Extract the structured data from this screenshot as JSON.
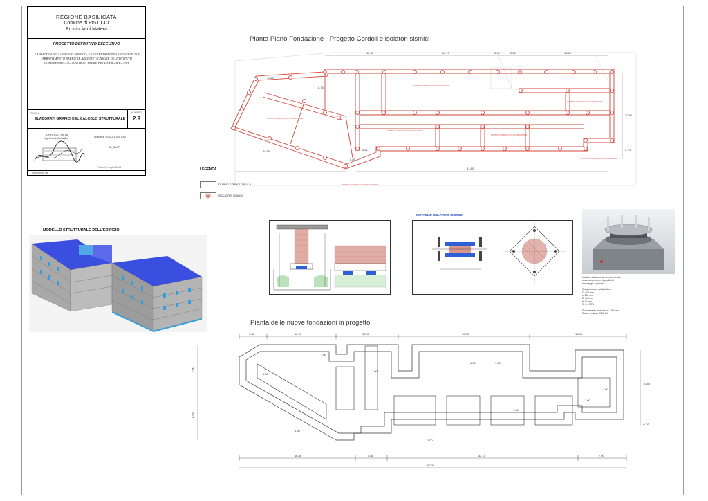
{
  "title_block": {
    "region": "REGIONE  BASILICATA",
    "comune": "Comune di PISTICCI",
    "provincia": "Provincia di Matera",
    "phase": "PROGETTO  DEFINITIVO-ESECUTIVO",
    "works": "LAVORI DI ADEGUAMENTO SISMICO, EFFICIENTAMENTO ENERGETICO E ABBATTIMENTO BARRIERE ARCHITETTONICHE DELL'ISTITUTO COMPRENSIVO SCOLASTICO \"PADRE PIO DA PIETRALCINA\"",
    "section_label": "TAVOLA",
    "drawing_title": "ELABORATI GRAFICI DEL CALCOLO STRUTTURALE",
    "number_label": "NUMERO",
    "drawing_number": "2.9",
    "designer_label": "IL PROGETTISTA",
    "designer_name": "Ing. Antonio Battaglini",
    "scale": "SEMBRE  SCALA  1:200 1:50",
    "file": "ID_N.N.P",
    "date": "Pisticci, lì luglio 2018",
    "footer": "Riferimento file:"
  },
  "plans": {
    "foundation_plan_title": "Pianta Piano Fondazione - Progetto Cordoli e isolatori sismici-",
    "new_foundations_title": "Pianta delle nuove fondazioni in progetto"
  },
  "legend": {
    "title": "LEGENDA",
    "items": [
      {
        "label": "DOPPIO CORDOLO IN C.A."
      },
      {
        "label": "ISOLATORI SISMICI"
      }
    ]
  },
  "top_plan_dims": {
    "top": [
      "12.45",
      "14.10",
      "5.90",
      "2.60",
      "15.15"
    ],
    "left": [
      "11.55",
      "8.75",
      "28.50"
    ],
    "mid": [
      "4.21",
      "5.86"
    ],
    "bottom": "51.60",
    "right": [
      "10.80",
      "2.70"
    ],
    "notes": [
      "DOPPIO CORDOLO DI FONDAZIONE",
      "DOPPIO CORDOLO DI FONDAZIONE",
      "DOPPIO CORDOLO DI FONDAZIONE",
      "DOPPIO CORDOLO DI FONDAZIONE",
      "DOPPIO CORDOLO DI FONDAZIONE",
      "DOPPIO CORDOLO DI FONDAZIONE",
      "DOPPIO CORDOLO DI FONDAZIONE"
    ]
  },
  "model": {
    "label": "MODELLO STRUTTURALE DELL'EDIFICIO"
  },
  "isolator_detail": {
    "label": "DETTAGLIO ISOLATORE SISMICO"
  },
  "photo_caption": [
    "Isolatore elastomerico armato ad alto",
    "smorzamento con dispositivi di",
    "ancoraggio a piastre",
    "",
    "Caratteristiche dell'isolatore",
    "D: 400 mm",
    "h: 212 mm",
    "Z: 400 mm",
    "tr: 51 mm",
    "G: 0.4 MPa",
    "",
    "Spostamento massimo +/- 150 mm",
    "Carico verticale 2500 kN"
  ],
  "new_plan_dims": {
    "top": [
      "3.80",
      "12.90",
      "12.90",
      "18.90",
      "15.33"
    ],
    "left": [
      "7.80",
      "8.64"
    ],
    "inner": [
      "1.00",
      "1.00",
      "1.00",
      "1.00",
      "1.00",
      "1.00",
      "1.00",
      "1.00",
      "1.00",
      "1.00"
    ],
    "bottom": [
      "16.86",
      "5.86",
      "32.15",
      "7.90"
    ],
    "total": "60.00",
    "right": [
      "10.80",
      "2.70"
    ]
  },
  "colors": {
    "cordolo_red": "#d4453a",
    "isolator_pink": "#e66a6a",
    "model_blue": "#3a4fe0",
    "model_grey": "#8c8c8c",
    "detail_brick": "#c96a5a",
    "detail_blue": "#2d5fd6"
  }
}
